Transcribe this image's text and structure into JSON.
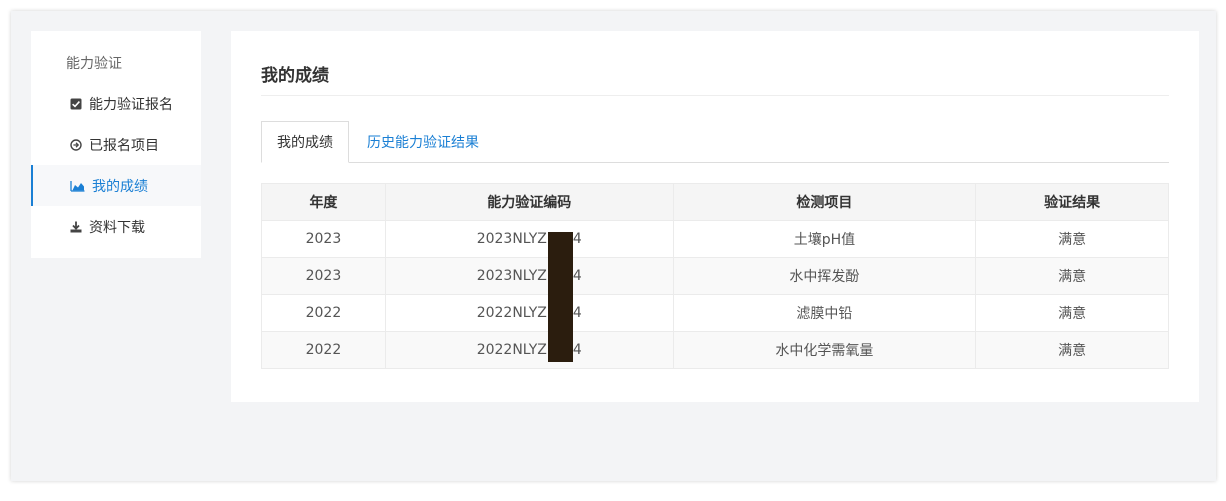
{
  "sidebar": {
    "heading": "能力验证",
    "items": [
      {
        "label": "能力验证报名",
        "icon": "checkbox-icon"
      },
      {
        "label": "已报名项目",
        "icon": "circle-arrow-icon"
      },
      {
        "label": "我的成绩",
        "icon": "area-chart-icon"
      },
      {
        "label": "资料下载",
        "icon": "download-icon"
      }
    ],
    "active_index": 2
  },
  "main": {
    "title": "我的成绩",
    "tabs": [
      {
        "label": "我的成绩"
      },
      {
        "label": "历史能力验证结果"
      }
    ],
    "table": {
      "headers": [
        "年度",
        "能力验证编码",
        "检测项目",
        "验证结果"
      ],
      "rows": [
        [
          "2023",
          "2023NLYZ",
          "土壤pH值",
          "满意"
        ],
        [
          "2023",
          "2023NLYZ",
          "水中挥发酚",
          "满意"
        ],
        [
          "2022",
          "2022NLYZ",
          "滤膜中铅",
          "满意"
        ],
        [
          "2022",
          "2022NLYZ",
          "水中化学需氧量",
          "满意"
        ]
      ],
      "code_suffixes": [
        "4",
        "4",
        "4",
        "4"
      ]
    }
  },
  "colors": {
    "accent": "#1a7fd4",
    "redaction": "#2b1d0e"
  }
}
